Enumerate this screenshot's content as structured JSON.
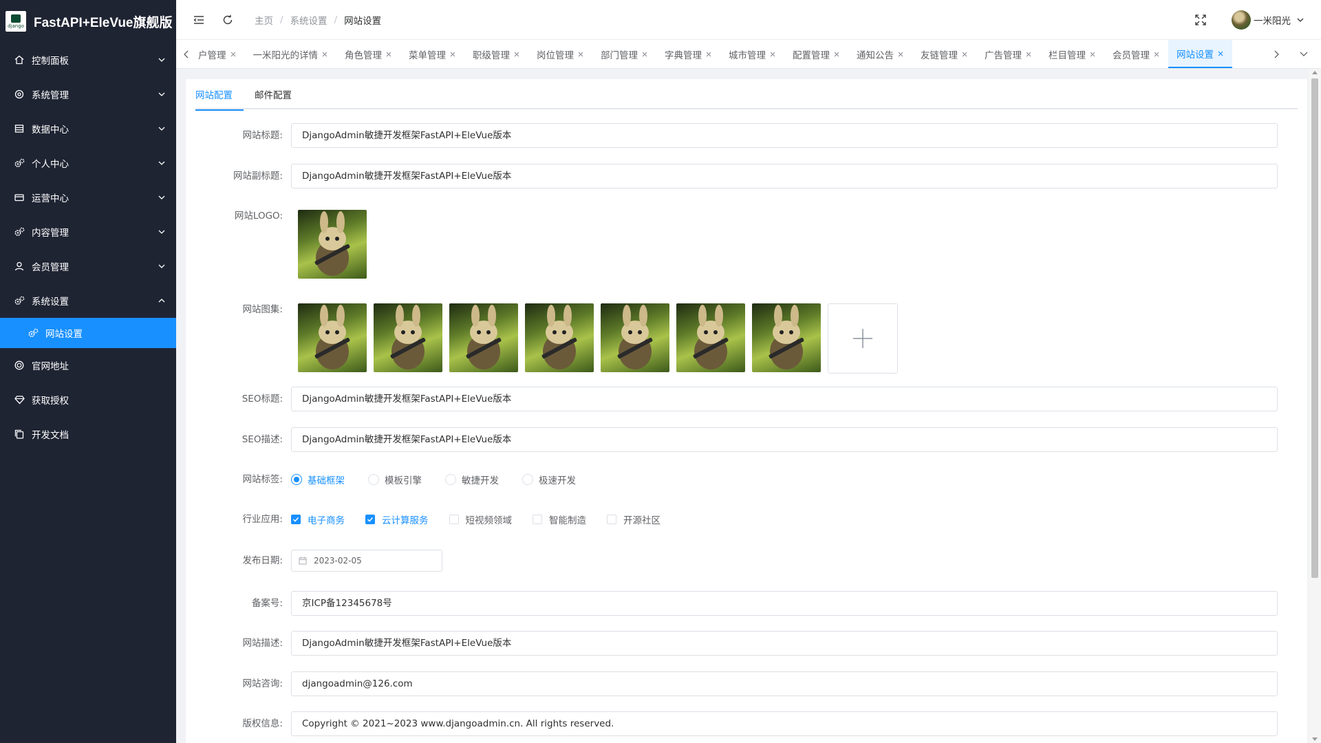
{
  "app": {
    "title": "FastAPI+EleVue旗舰版",
    "logo_text": "django"
  },
  "colors": {
    "sidebar_bg": "#1f2433",
    "accent": "#1890ff",
    "border": "#dcdfe6"
  },
  "sidebar": {
    "items": [
      {
        "label": "控制面板",
        "icon": "home-icon",
        "expanded": false
      },
      {
        "label": "系统管理",
        "icon": "settings-icon",
        "expanded": false
      },
      {
        "label": "数据中心",
        "icon": "database-icon",
        "expanded": false
      },
      {
        "label": "个人中心",
        "icon": "gears-icon",
        "expanded": false
      },
      {
        "label": "运营中心",
        "icon": "card-icon",
        "expanded": false
      },
      {
        "label": "内容管理",
        "icon": "gears-icon",
        "expanded": false
      },
      {
        "label": "会员管理",
        "icon": "user-icon",
        "expanded": false
      },
      {
        "label": "系统设置",
        "icon": "gears-icon",
        "expanded": true
      },
      {
        "label": "网站设置",
        "icon": "gears-icon",
        "active": true
      },
      {
        "label": "官网地址",
        "icon": "globe-icon"
      },
      {
        "label": "获取授权",
        "icon": "diamond-icon"
      },
      {
        "label": "开发文档",
        "icon": "copy-icon"
      }
    ]
  },
  "header": {
    "breadcrumb": [
      "主页",
      "系统设置",
      "网站设置"
    ],
    "user_name": "一米阳光"
  },
  "tabs": {
    "items": [
      {
        "label": "户管理",
        "active": false
      },
      {
        "label": "一米阳光的详情",
        "active": false
      },
      {
        "label": "角色管理",
        "active": false
      },
      {
        "label": "菜单管理",
        "active": false
      },
      {
        "label": "职级管理",
        "active": false
      },
      {
        "label": "岗位管理",
        "active": false
      },
      {
        "label": "部门管理",
        "active": false
      },
      {
        "label": "字典管理",
        "active": false
      },
      {
        "label": "城市管理",
        "active": false
      },
      {
        "label": "配置管理",
        "active": false
      },
      {
        "label": "通知公告",
        "active": false
      },
      {
        "label": "友链管理",
        "active": false
      },
      {
        "label": "广告管理",
        "active": false
      },
      {
        "label": "栏目管理",
        "active": false
      },
      {
        "label": "会员管理",
        "active": false
      },
      {
        "label": "网站设置",
        "active": true
      }
    ]
  },
  "form_tabs": [
    {
      "label": "网站配置",
      "active": true
    },
    {
      "label": "邮件配置",
      "active": false
    }
  ],
  "form": {
    "site_title": {
      "label": "网站标题:",
      "value": "DjangoAdmin敏捷开发框架FastAPI+EleVue版本"
    },
    "site_subtitle": {
      "label": "网站副标题:",
      "value": "DjangoAdmin敏捷开发框架FastAPI+EleVue版本"
    },
    "site_logo": {
      "label": "网站LOGO:"
    },
    "site_gallery": {
      "label": "网站图集:",
      "count": 7
    },
    "seo_title": {
      "label": "SEO标题:",
      "value": "DjangoAdmin敏捷开发框架FastAPI+EleVue版本"
    },
    "seo_desc": {
      "label": "SEO描述:",
      "value": "DjangoAdmin敏捷开发框架FastAPI+EleVue版本"
    },
    "site_tags": {
      "label": "网站标签:",
      "options": [
        {
          "label": "基础框架",
          "checked": true
        },
        {
          "label": "模板引擎",
          "checked": false
        },
        {
          "label": "敏捷开发",
          "checked": false
        },
        {
          "label": "极速开发",
          "checked": false
        }
      ]
    },
    "industry": {
      "label": "行业应用:",
      "options": [
        {
          "label": "电子商务",
          "checked": true
        },
        {
          "label": "云计算服务",
          "checked": true
        },
        {
          "label": "短视频领域",
          "checked": false
        },
        {
          "label": "智能制造",
          "checked": false
        },
        {
          "label": "开源社区",
          "checked": false
        }
      ]
    },
    "publish_date": {
      "label": "发布日期:",
      "value": "2023-02-05"
    },
    "icp": {
      "label": "备案号:",
      "value": "京ICP备12345678号"
    },
    "site_desc": {
      "label": "网站描述:",
      "value": "DjangoAdmin敏捷开发框架FastAPI+EleVue版本"
    },
    "contact": {
      "label": "网站咨询:",
      "value": "djangoadmin@126.com"
    },
    "copyright": {
      "label": "版权信息:",
      "value": "Copyright © 2021~2023 www.djangoadmin.cn. All rights reserved."
    }
  }
}
